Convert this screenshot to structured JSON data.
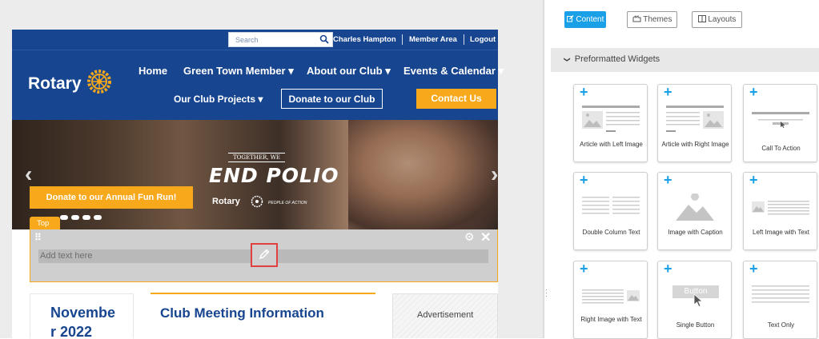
{
  "site": {
    "topbar": {
      "search_placeholder": "Search",
      "user_name": "Charles Hampton",
      "member_area": "Member Area",
      "logout": "Logout"
    },
    "logo_text": "Rotary",
    "nav": {
      "home": "Home",
      "green_town": "Green Town Member",
      "about": "About our Club",
      "events": "Events & Calendar",
      "projects": "Our Club Projects",
      "dropdown_glyph": "▾",
      "donate_club": "Donate to our Club",
      "contact": "Contact Us"
    },
    "hero": {
      "together": "TOGETHER, WE",
      "end_polio": "END POLIO",
      "rotary": "Rotary",
      "people_of_action": "PEOPLE OF ACTION",
      "fun_run_button": "Donate to our Annual Fun Run!",
      "slide_count": 4,
      "prev_arrow": "‹",
      "next_arrow": "›"
    },
    "editor": {
      "section_tab": "Top",
      "placeholder": "Add text here",
      "grip_glyph": "⠿",
      "gear_glyph": "⚙",
      "close_glyph": "✕"
    },
    "content": {
      "calendar_month": "November 2022",
      "club_meeting_title": "Club Meeting Information",
      "advertisement": "Advertisement"
    },
    "colors": {
      "brand_blue": "#17458f",
      "brand_gold": "#f7a81b",
      "highlight_red": "#e04040"
    }
  },
  "panel": {
    "tabs": {
      "content": "Content",
      "themes": "Themes",
      "layouts": "Layouts"
    },
    "section_title": "Preformatted Widgets",
    "section_chevron": "❯",
    "widgets": [
      {
        "label": "Article with Left Image",
        "icon": "article-left-image-icon"
      },
      {
        "label": "Article with Right Image",
        "icon": "article-right-image-icon"
      },
      {
        "label": "Call To Action",
        "icon": "call-to-action-icon"
      },
      {
        "label": "Double Column Text",
        "icon": "double-column-icon"
      },
      {
        "label": "Image with Caption",
        "icon": "image-caption-icon"
      },
      {
        "label": "Left Image with Text",
        "icon": "left-image-text-icon"
      },
      {
        "label": "Right Image with Text",
        "icon": "right-image-text-icon"
      },
      {
        "label": "Single Button",
        "icon": "single-button-icon",
        "thumb_text": "Button"
      },
      {
        "label": "Text Only",
        "icon": "text-only-icon"
      }
    ],
    "add_glyph": "+"
  }
}
